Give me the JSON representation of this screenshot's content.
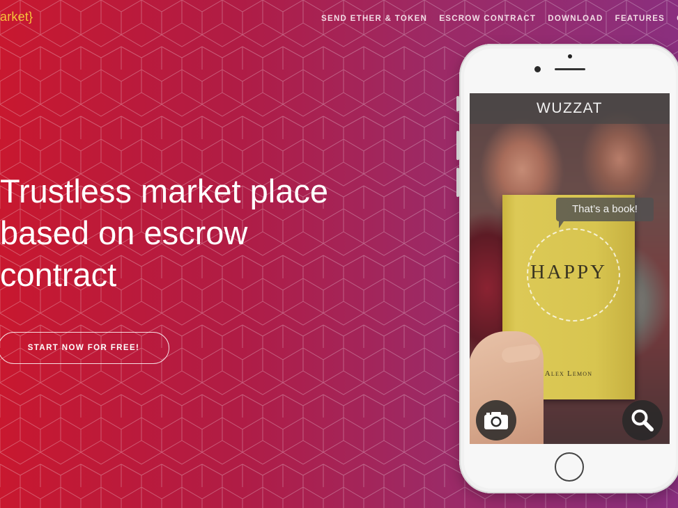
{
  "brand": {
    "logo_text": "arket}",
    "logo_color": "#f6c23a"
  },
  "nav": {
    "items": [
      "SEND ETHER & TOKEN",
      "ESCROW CONTRACT",
      "DOWNLOAD",
      "FEATURES",
      "C"
    ]
  },
  "hero": {
    "title_lines": [
      "Trustless market place",
      "based on escrow",
      "contract"
    ],
    "cta_label": "START NOW FOR FREE!"
  },
  "phone": {
    "app_name": "WUZZAT",
    "bubble_text": "That’s a book!",
    "book_title": "HAPPY",
    "book_author": "Alex Lemon",
    "camera_button_icon": "camera-icon",
    "search_button_icon": "magnifier-icon"
  },
  "colors": {
    "gradient_left": "#c8182f",
    "gradient_right": "#8a2f7e",
    "accent": "#f6c23a"
  }
}
